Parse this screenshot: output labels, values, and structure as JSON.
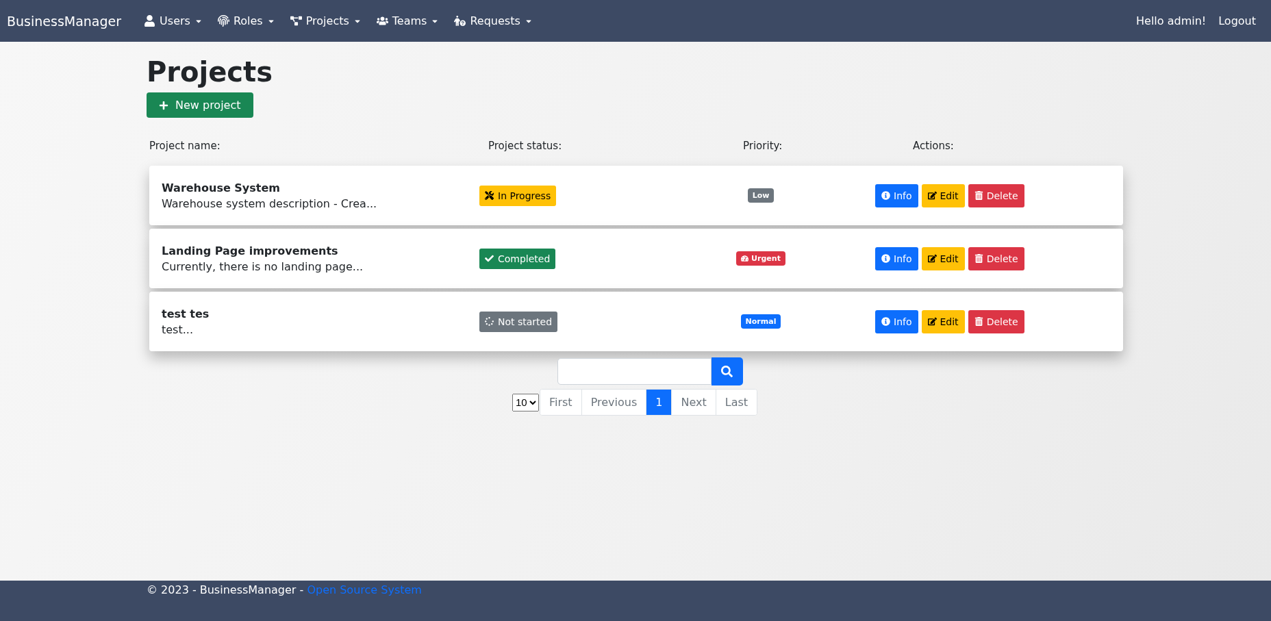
{
  "navbar": {
    "brand": "BusinessManager",
    "menus": [
      {
        "label": "Users"
      },
      {
        "label": "Roles"
      },
      {
        "label": "Projects"
      },
      {
        "label": "Teams"
      },
      {
        "label": "Requests"
      }
    ],
    "greeting": "Hello admin!",
    "logout": "Logout"
  },
  "page": {
    "title": "Projects",
    "new_button": "New project"
  },
  "table": {
    "columns": [
      "Project name:",
      "Project status:",
      "Priority:",
      "Actions:"
    ],
    "rows": [
      {
        "name": "Warehouse System",
        "description": "Warehouse system description - Crea...",
        "status": {
          "kind": "in_progress",
          "label": "In Progress"
        },
        "priority": {
          "kind": "low",
          "label": "Low"
        },
        "actions": [
          "Info",
          "Edit",
          "Delete"
        ]
      },
      {
        "name": "Landing Page improvements",
        "description": "Currently, there is no landing page...",
        "status": {
          "kind": "completed",
          "label": "Completed"
        },
        "priority": {
          "kind": "urgent",
          "label": "Urgent"
        },
        "actions": [
          "Info",
          "Edit",
          "Delete"
        ]
      },
      {
        "name": "test tes",
        "description": "test...",
        "status": {
          "kind": "not_started",
          "label": "Not started"
        },
        "priority": {
          "kind": "normal",
          "label": "Normal"
        },
        "actions": [
          "Info",
          "Edit",
          "Delete"
        ]
      }
    ]
  },
  "pagination": {
    "page_size": "10",
    "items": [
      {
        "label": "First",
        "selected": false
      },
      {
        "label": "Previous",
        "selected": false
      },
      {
        "label": "1",
        "selected": true
      },
      {
        "label": "Next",
        "selected": false
      },
      {
        "label": "Last",
        "selected": false
      }
    ]
  },
  "footer": {
    "text": "© 2023 - BusinessManager -",
    "link": "Open Source System"
  }
}
